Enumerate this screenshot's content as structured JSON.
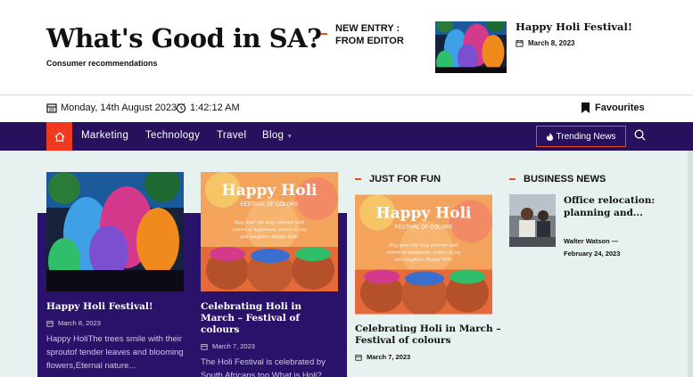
{
  "site": {
    "title": "What's Good in SA?",
    "tagline": "Consumer recommendations"
  },
  "editor": {
    "label_line1": "NEW ENTRY :",
    "label_line2": "FROM EDITOR",
    "post_title": "Happy Holi Festival!",
    "post_date": "March 8, 2023"
  },
  "infobar": {
    "date": "Monday, 14th August 2023",
    "time": "1:42:12 AM",
    "favourites": "Favourites"
  },
  "nav": {
    "items": [
      "Marketing",
      "Technology",
      "Travel",
      "Blog"
    ],
    "trending": "Trending News"
  },
  "posts": [
    {
      "title": "Happy Holi Festival!",
      "date": "March 8, 2023",
      "excerpt": "Happy HoliThe trees smile with their sproutof tender leaves and blooming flowers,Eternal nature..."
    },
    {
      "title": "Celebrating Holi in March – Festival of colours",
      "date": "March 7, 2023",
      "excerpt": "The Holi Festival is celebrated by South Africans too What is Holi? Holi is a popular Hindu festival..."
    }
  ],
  "just_for_fun": {
    "heading": "JUST FOR FUN",
    "title": "Celebrating Holi in March – Festival of colours",
    "date": "March 7, 2023"
  },
  "business": {
    "heading": "BUSINESS NEWS",
    "title": "Office relocation: planning and...",
    "author": "Walter Watson",
    "date": "February 24, 2023"
  },
  "holi_banner": {
    "headline": "Happy Holi",
    "subline": "FESTIVAL OF COLORS",
    "message": "May your life stay colored with colors of happiness, colors of joy and laughter. Happy Holi!"
  },
  "colors": {
    "accent": "#e8501f",
    "nav_bg": "#27115d",
    "panel_bg": "#2a1169",
    "content_bg": "#e7f2f0"
  }
}
